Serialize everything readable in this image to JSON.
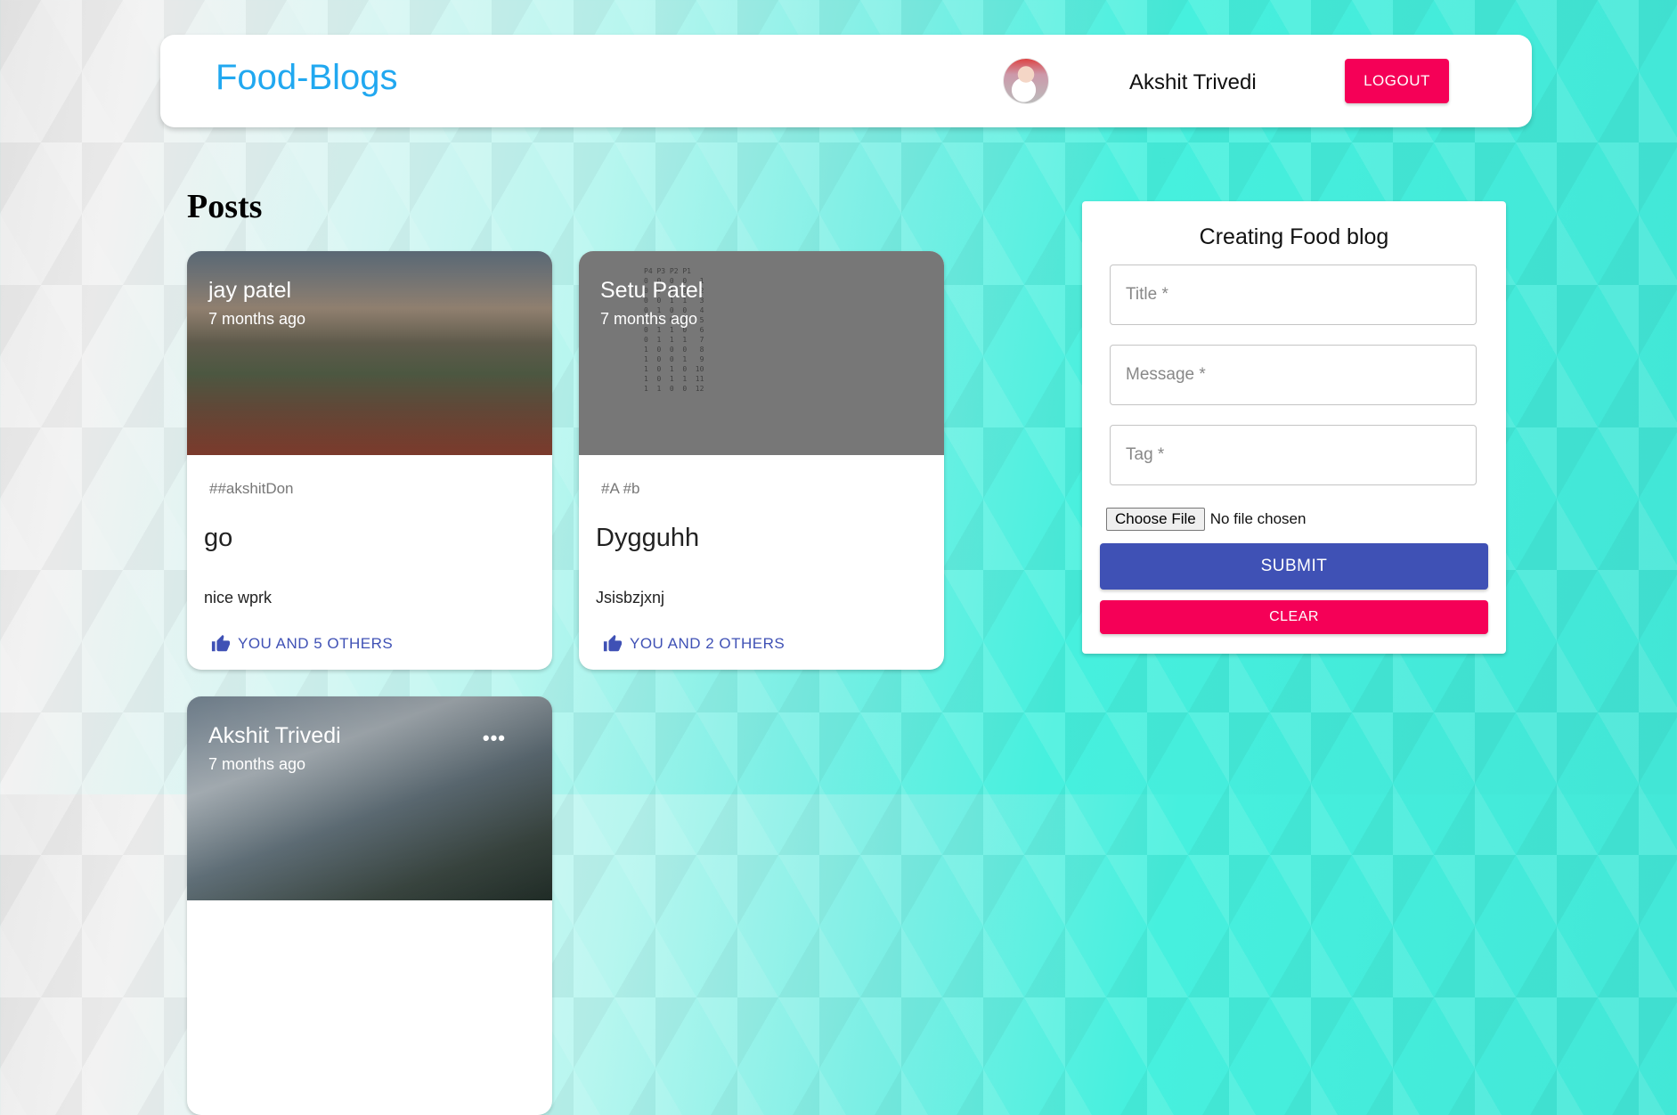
{
  "header": {
    "brand": "Food-Blogs",
    "user_name": "Akshit Trivedi",
    "logout_label": "LOGOUT"
  },
  "posts_heading": "Posts",
  "posts": [
    {
      "author": "jay patel",
      "time": "7 months ago",
      "tags": "##akshitDon",
      "title": "go",
      "message": "nice wprk",
      "likes": "YOU AND 5 OTHERS"
    },
    {
      "author": "Setu Patel",
      "time": "7 months ago",
      "tags": "#A #b",
      "title": "Dygguhh",
      "message": "Jsisbzjxnj",
      "likes": "YOU AND 2 OTHERS"
    },
    {
      "author": "Akshit Trivedi",
      "time": "7 months ago"
    }
  ],
  "post2_image_text": "P4 P3 P2 P1\n0  0  0  0   1\n0  0  1  0   2\n0  0  1  1   3\n0  1  0  0   4\n0  1  0  1   5\n0  1  1  0   6\n0  1  1  1   7\n1  0  0  0   8\n1  0  0  1   9\n1  0  1  0  10\n1  0  1  1  11\n1  1  0  0  12",
  "form": {
    "title": "Creating Food blog",
    "title_placeholder": "Title *",
    "message_placeholder": "Message *",
    "tag_placeholder": "Tag *",
    "file_button": "Choose File",
    "file_status": "No file chosen",
    "submit_label": "SUBMIT",
    "clear_label": "CLEAR"
  }
}
